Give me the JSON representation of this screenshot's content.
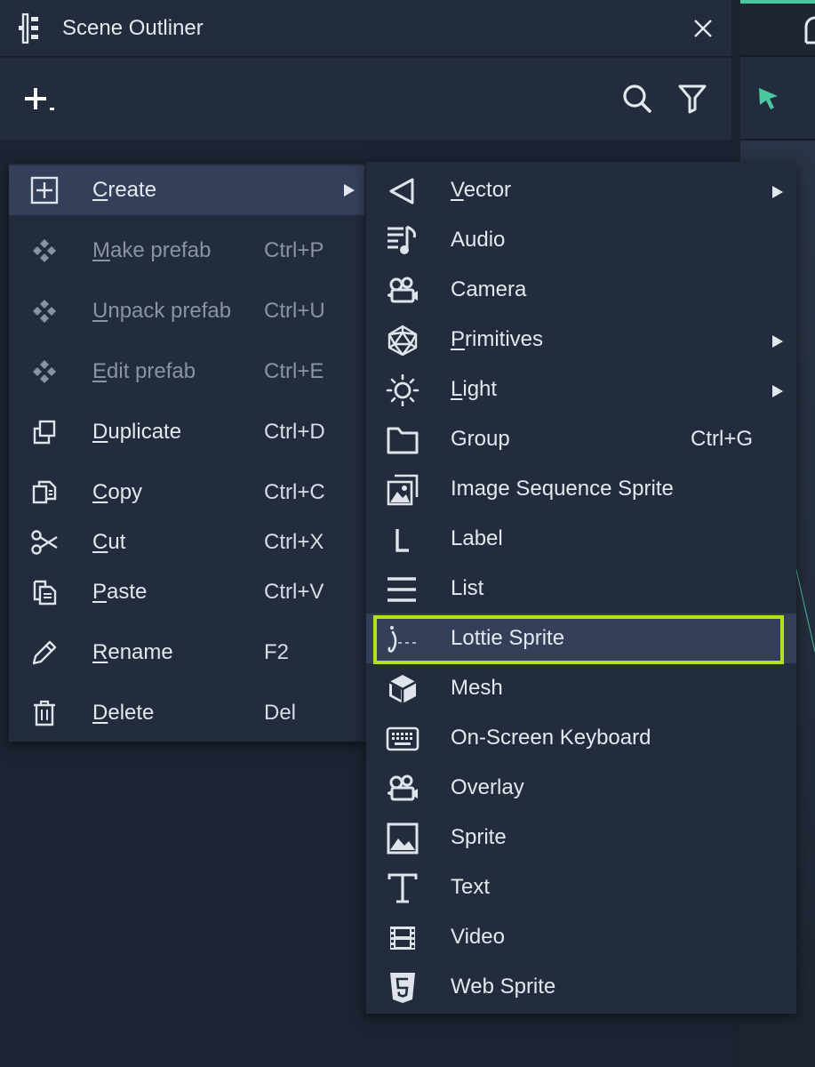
{
  "panel": {
    "title": "Scene Outliner",
    "toolbar": {
      "add_icon": "add-icon",
      "search_icon": "search-icon",
      "filter_icon": "filter-icon"
    }
  },
  "context_menu": {
    "items": [
      {
        "label_mn": "C",
        "label_rest": "reate",
        "shortcut": "",
        "icon": "create-square-plus-icon",
        "submenu": true,
        "disabled": false
      },
      {
        "label_mn": "M",
        "label_rest": "ake prefab",
        "shortcut": "Ctrl+P",
        "icon": "prefab-icon",
        "submenu": false,
        "disabled": true
      },
      {
        "label_mn": "U",
        "label_rest": "npack prefab",
        "shortcut": "Ctrl+U",
        "icon": "prefab-icon",
        "submenu": false,
        "disabled": true
      },
      {
        "label_mn": "E",
        "label_rest": "dit prefab",
        "shortcut": "Ctrl+E",
        "icon": "prefab-icon",
        "submenu": false,
        "disabled": true
      },
      {
        "label_mn": "D",
        "label_rest": "uplicate",
        "shortcut": "Ctrl+D",
        "icon": "duplicate-icon",
        "submenu": false,
        "disabled": false
      },
      {
        "label_mn": "C",
        "label_rest": "opy",
        "shortcut": "Ctrl+C",
        "icon": "copy-icon",
        "submenu": false,
        "disabled": false
      },
      {
        "label_mn": "C",
        "label_rest": "ut",
        "shortcut": "Ctrl+X",
        "icon": "scissors-icon",
        "submenu": false,
        "disabled": false
      },
      {
        "label_mn": "P",
        "label_rest": "aste",
        "shortcut": "Ctrl+V",
        "icon": "paste-icon",
        "submenu": false,
        "disabled": false
      },
      {
        "label_mn": "R",
        "label_rest": "ename",
        "shortcut": "F2",
        "icon": "pencil-icon",
        "submenu": false,
        "disabled": false
      },
      {
        "label_mn": "D",
        "label_rest": "elete",
        "shortcut": "Del",
        "icon": "trash-icon",
        "submenu": false,
        "disabled": false
      }
    ]
  },
  "create_submenu": {
    "items": [
      {
        "label_mn": "V",
        "label_rest": "ector",
        "shortcut": "",
        "icon": "vector-icon",
        "submenu": true
      },
      {
        "label_mn": "",
        "label_rest": "Audio",
        "shortcut": "",
        "icon": "audio-icon",
        "submenu": false
      },
      {
        "label_mn": "",
        "label_rest": "Camera",
        "shortcut": "",
        "icon": "camera-icon",
        "submenu": false
      },
      {
        "label_mn": "P",
        "label_rest": "rimitives",
        "shortcut": "",
        "icon": "primitives-icon",
        "submenu": true
      },
      {
        "label_mn": "L",
        "label_rest": "ight",
        "shortcut": "",
        "icon": "light-icon",
        "submenu": true
      },
      {
        "label_mn": "",
        "label_rest": "Group",
        "shortcut": "Ctrl+G",
        "icon": "folder-icon",
        "submenu": false
      },
      {
        "label_mn": "",
        "label_rest": "Image Sequence Sprite",
        "shortcut": "",
        "icon": "image-sequence-icon",
        "submenu": false
      },
      {
        "label_mn": "",
        "label_rest": "Label",
        "shortcut": "",
        "icon": "label-icon",
        "submenu": false
      },
      {
        "label_mn": "",
        "label_rest": "List",
        "shortcut": "",
        "icon": "list-icon",
        "submenu": false
      },
      {
        "label_mn": "",
        "label_rest": "Lottie Sprite",
        "shortcut": "",
        "icon": "lottie-icon",
        "submenu": false
      },
      {
        "label_mn": "",
        "label_rest": "Mesh",
        "shortcut": "",
        "icon": "mesh-cube-icon",
        "submenu": false
      },
      {
        "label_mn": "",
        "label_rest": "On-Screen Keyboard",
        "shortcut": "",
        "icon": "keyboard-icon",
        "submenu": false
      },
      {
        "label_mn": "",
        "label_rest": "Overlay",
        "shortcut": "",
        "icon": "overlay-icon",
        "submenu": false
      },
      {
        "label_mn": "",
        "label_rest": "Sprite",
        "shortcut": "",
        "icon": "sprite-image-icon",
        "submenu": false
      },
      {
        "label_mn": "",
        "label_rest": "Text",
        "shortcut": "",
        "icon": "text-icon",
        "submenu": false
      },
      {
        "label_mn": "",
        "label_rest": "Video",
        "shortcut": "",
        "icon": "video-film-icon",
        "submenu": false
      },
      {
        "label_mn": "",
        "label_rest": "Web Sprite",
        "shortcut": "",
        "icon": "html5-icon",
        "submenu": false
      }
    ],
    "highlighted_item": "Lottie Sprite"
  },
  "colors": {
    "panel_bg": "#1c2433",
    "menu_bg": "#232c3c",
    "active_bg": "#34405a",
    "highlight_border": "#b4e021",
    "accent_green": "#4bc8a0"
  }
}
